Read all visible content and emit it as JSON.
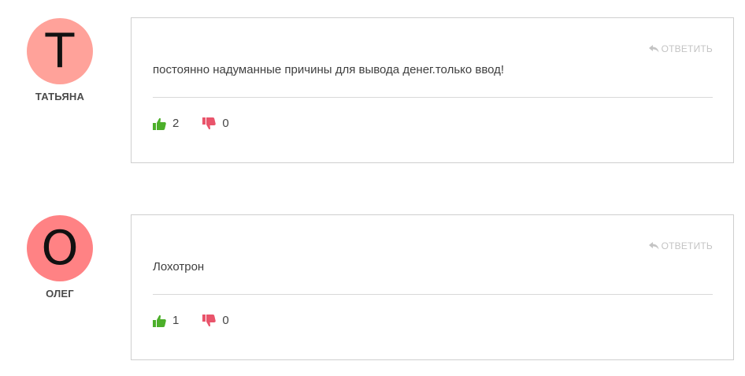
{
  "comments": [
    {
      "avatar_letter": "Т",
      "avatar_color": "#ffa29a",
      "author": "ТАТЬЯНА",
      "reply_label": "ОТВЕТИТЬ",
      "text": "постоянно надуманные причины для вывода денег.только ввод!",
      "likes": "2",
      "dislikes": "0"
    },
    {
      "avatar_letter": "О",
      "avatar_color": "#ff8284",
      "author": "ОЛЕГ",
      "reply_label": "ОТВЕТИТЬ",
      "text": "Лохотрон",
      "likes": "1",
      "dislikes": "0"
    }
  ],
  "colors": {
    "like": "#4caf2a",
    "dislike": "#e9546b",
    "reply": "#c4c4c4"
  },
  "icons": {
    "reply": "reply-arrow-icon",
    "like": "thumbs-up-icon",
    "dislike": "thumbs-down-icon"
  }
}
